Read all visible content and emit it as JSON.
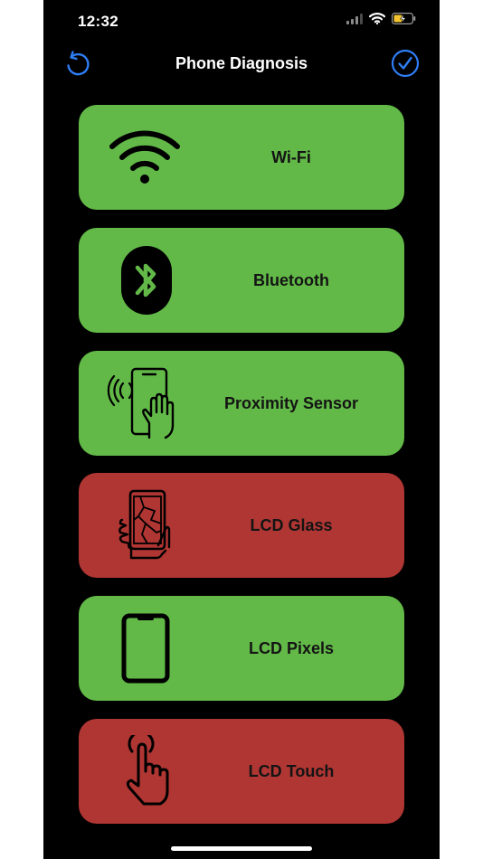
{
  "status_bar": {
    "time": "12:32"
  },
  "nav": {
    "title": "Phone Diagnosis",
    "back_icon": "undo-arrow-icon",
    "done_icon": "checkmark-circle-icon"
  },
  "colors": {
    "pass": "#62b948",
    "fail": "#af3633",
    "accent": "#2f7df5"
  },
  "tests": [
    {
      "label": "Wi-Fi",
      "status": "pass",
      "icon": "wifi-icon"
    },
    {
      "label": "Bluetooth",
      "status": "pass",
      "icon": "bluetooth-icon"
    },
    {
      "label": "Proximity Sensor",
      "status": "pass",
      "icon": "proximity-hand-icon"
    },
    {
      "label": "LCD Glass",
      "status": "fail",
      "icon": "cracked-phone-icon"
    },
    {
      "label": "LCD Pixels",
      "status": "pass",
      "icon": "phone-outline-icon"
    },
    {
      "label": "LCD Touch",
      "status": "fail",
      "icon": "finger-touch-icon"
    }
  ]
}
